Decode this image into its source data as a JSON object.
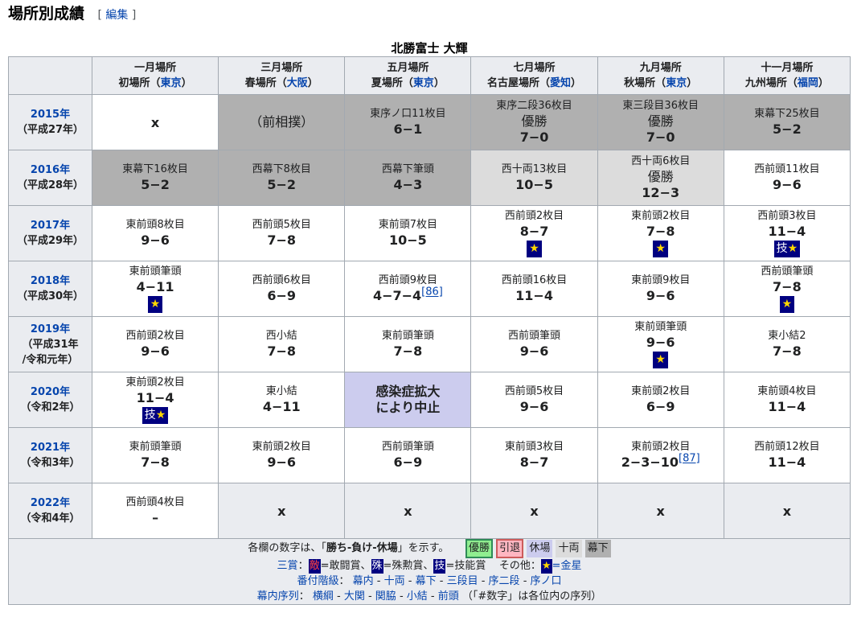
{
  "heading": {
    "title": "場所別成績",
    "edit_open": "[",
    "edit_label": "編集",
    "edit_close": "]"
  },
  "caption": "北勝富士 大輝",
  "columns": [
    {
      "month": "一月場所",
      "venue": "初場所",
      "city": "東京"
    },
    {
      "month": "三月場所",
      "venue": "春場所",
      "city": "大阪"
    },
    {
      "month": "五月場所",
      "venue": "夏場所",
      "city": "東京"
    },
    {
      "month": "七月場所",
      "venue": "名古屋場所",
      "city": "愛知"
    },
    {
      "month": "九月場所",
      "venue": "秋場所",
      "city": "東京"
    },
    {
      "month": "十一月場所",
      "venue": "九州場所",
      "city": "福岡"
    }
  ],
  "rows": [
    {
      "year": "2015年",
      "era": "（平成27年）",
      "cells": [
        {
          "type": "x",
          "text": "x",
          "bg": "white"
        },
        {
          "type": "note",
          "text": "（前相撲）",
          "bg": "makushita"
        },
        {
          "type": "rec",
          "rank": "東序ノ口11枚目",
          "record": "6−1",
          "bg": "makushita"
        },
        {
          "type": "rec",
          "rank": "東序二段36枚目",
          "yusho": "優勝",
          "record": "7−0",
          "bg": "makushita"
        },
        {
          "type": "rec",
          "rank": "東三段目36枚目",
          "yusho": "優勝",
          "record": "7−0",
          "bg": "makushita"
        },
        {
          "type": "rec",
          "rank": "東幕下25枚目",
          "record": "5−2",
          "bg": "makushita"
        }
      ]
    },
    {
      "year": "2016年",
      "era": "（平成28年）",
      "cells": [
        {
          "type": "rec",
          "rank": "東幕下16枚目",
          "record": "5−2",
          "bg": "makushita"
        },
        {
          "type": "rec",
          "rank": "西幕下8枚目",
          "record": "5−2",
          "bg": "makushita"
        },
        {
          "type": "rec",
          "rank": "西幕下筆頭",
          "record": "4−3",
          "bg": "makushita"
        },
        {
          "type": "rec",
          "rank": "西十両13枚目",
          "record": "10−5",
          "bg": "juryo"
        },
        {
          "type": "rec",
          "rank": "西十両6枚目",
          "yusho": "優勝",
          "record": "12−3",
          "bg": "juryo"
        },
        {
          "type": "rec",
          "rank": "西前頭11枚目",
          "record": "9−6",
          "bg": "white"
        }
      ]
    },
    {
      "year": "2017年",
      "era": "（平成29年）",
      "cells": [
        {
          "type": "rec",
          "rank": "東前頭8枚目",
          "record": "9−6",
          "bg": "white"
        },
        {
          "type": "rec",
          "rank": "西前頭5枚目",
          "record": "7−8",
          "bg": "white"
        },
        {
          "type": "rec",
          "rank": "東前頭7枚目",
          "record": "10−5",
          "bg": "white"
        },
        {
          "type": "rec",
          "rank": "西前頭2枚目",
          "record": "8−7",
          "star": "★",
          "bg": "white"
        },
        {
          "type": "rec",
          "rank": "東前頭2枚目",
          "record": "7−8",
          "star": "★",
          "bg": "white"
        },
        {
          "type": "rec",
          "rank": "西前頭3枚目",
          "record": "11−4",
          "prize": "技",
          "star": "★",
          "bg": "white"
        }
      ]
    },
    {
      "year": "2018年",
      "era": "（平成30年）",
      "cells": [
        {
          "type": "rec",
          "rank": "東前頭筆頭",
          "record": "4−11",
          "star": "★",
          "bg": "white"
        },
        {
          "type": "rec",
          "rank": "西前頭6枚目",
          "record": "6−9",
          "bg": "white"
        },
        {
          "type": "rec",
          "rank": "西前頭9枚目",
          "record": "4−7−4",
          "ref": "[86]",
          "bg": "white"
        },
        {
          "type": "rec",
          "rank": "西前頭16枚目",
          "record": "11−4",
          "bg": "white"
        },
        {
          "type": "rec",
          "rank": "東前頭9枚目",
          "record": "9−6",
          "bg": "white"
        },
        {
          "type": "rec",
          "rank": "西前頭筆頭",
          "record": "7−8",
          "star": "★",
          "bg": "white"
        }
      ]
    },
    {
      "year": "2019年",
      "era": "（平成31年",
      "era2": "/令和元年）",
      "cells": [
        {
          "type": "rec",
          "rank": "西前頭2枚目",
          "record": "9−6",
          "bg": "white"
        },
        {
          "type": "rec",
          "rank": "西小結",
          "record": "7−8",
          "bg": "white"
        },
        {
          "type": "rec",
          "rank": "東前頭筆頭",
          "record": "7−8",
          "bg": "white"
        },
        {
          "type": "rec",
          "rank": "西前頭筆頭",
          "record": "9−6",
          "bg": "white"
        },
        {
          "type": "rec",
          "rank": "東前頭筆頭",
          "record": "9−6",
          "star": "★",
          "bg": "white"
        },
        {
          "type": "rec",
          "rank": "東小結2",
          "record": "7−8",
          "bg": "white"
        }
      ]
    },
    {
      "year": "2020年",
      "era": "（令和2年）",
      "cells": [
        {
          "type": "rec",
          "rank": "東前頭2枚目",
          "record": "11−4",
          "prize": "技",
          "star": "★",
          "bg": "white"
        },
        {
          "type": "rec",
          "rank": "東小結",
          "record": "4−11",
          "bg": "white"
        },
        {
          "type": "stopped",
          "line1": "感染症拡大",
          "line2": "により中止",
          "bg": "kyujo"
        },
        {
          "type": "rec",
          "rank": "西前頭5枚目",
          "record": "9−6",
          "bg": "white"
        },
        {
          "type": "rec",
          "rank": "東前頭2枚目",
          "record": "6−9",
          "bg": "white"
        },
        {
          "type": "rec",
          "rank": "東前頭4枚目",
          "record": "11−4",
          "bg": "white"
        }
      ]
    },
    {
      "year": "2021年",
      "era": "（令和3年）",
      "cells": [
        {
          "type": "rec",
          "rank": "東前頭筆頭",
          "record": "7−8",
          "bg": "white"
        },
        {
          "type": "rec",
          "rank": "東前頭2枚目",
          "record": "9−6",
          "bg": "white"
        },
        {
          "type": "rec",
          "rank": "西前頭筆頭",
          "record": "6−9",
          "bg": "white"
        },
        {
          "type": "rec",
          "rank": "東前頭3枚目",
          "record": "8−7",
          "bg": "white"
        },
        {
          "type": "rec",
          "rank": "東前頭2枚目",
          "record": "2−3−10",
          "ref": "[87]",
          "bg": "white"
        },
        {
          "type": "rec",
          "rank": "西前頭12枚目",
          "record": "11−4",
          "bg": "white"
        }
      ]
    },
    {
      "year": "2022年",
      "era": "（令和4年）",
      "cells": [
        {
          "type": "rec",
          "rank": "西前頭4枚目",
          "record": "–",
          "bg": "white"
        },
        {
          "type": "x",
          "text": "x",
          "bg": "none"
        },
        {
          "type": "x",
          "text": "x",
          "bg": "none"
        },
        {
          "type": "x",
          "text": "x",
          "bg": "none"
        },
        {
          "type": "x",
          "text": "x",
          "bg": "none"
        },
        {
          "type": "x",
          "text": "x",
          "bg": "none"
        }
      ]
    }
  ],
  "footer": {
    "line1_pre": "各欄の数字は、「",
    "line1_bold": "勝ち-負け-休場",
    "line1_post": "」を示す。",
    "legend": [
      "優勝",
      "引退",
      "休場",
      "十両",
      "幕下"
    ],
    "sansho_label": "三賞",
    "sansho_items": [
      {
        "sym": "敵",
        "text": "=敢闘賞、"
      },
      {
        "sym": "殊",
        "text": "=殊勲賞、"
      },
      {
        "sym": "技",
        "text": "=技能賞"
      }
    ],
    "other_label": "その他：",
    "kinboshi_sym": "★",
    "kinboshi_text": "=金星",
    "banzuke_label": "番付階級",
    "banzuke_items": [
      "幕内",
      "十両",
      "幕下",
      "三段目",
      "序二段",
      "序ノ口"
    ],
    "makuuchi_label": "幕内序列",
    "makuuchi_items": [
      "横綱",
      "大関",
      "関脇",
      "小結",
      "前頭"
    ],
    "makuuchi_note": "（「#数字」は各位内の序列）"
  }
}
